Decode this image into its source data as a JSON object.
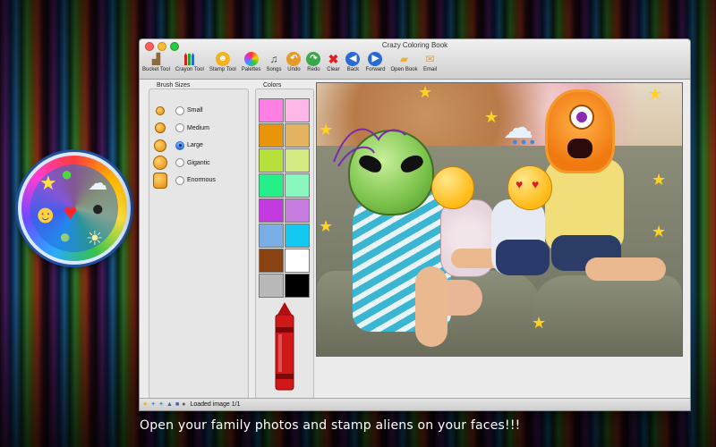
{
  "window": {
    "title": "Crazy Coloring Book"
  },
  "toolbar": {
    "items": [
      {
        "label": "Bucket Tool"
      },
      {
        "label": "Crayon Tool"
      },
      {
        "label": "Stamp Tool"
      },
      {
        "label": "Palettes"
      },
      {
        "label": "Songs"
      },
      {
        "label": "Undo"
      },
      {
        "label": "Redo"
      },
      {
        "label": "Clear"
      },
      {
        "label": "Back"
      },
      {
        "label": "Forward"
      },
      {
        "label": "Open Book"
      },
      {
        "label": "Email"
      }
    ]
  },
  "brush_sizes": {
    "title": "Brush Sizes",
    "options": [
      {
        "label": "Small",
        "selected": false
      },
      {
        "label": "Medium",
        "selected": false
      },
      {
        "label": "Large",
        "selected": true
      },
      {
        "label": "Gigantic",
        "selected": false
      },
      {
        "label": "Enormous",
        "selected": false
      }
    ]
  },
  "colors": {
    "title": "Colors",
    "swatches": [
      "#ff7fe5",
      "#ffb7ea",
      "#e8950b",
      "#e4b361",
      "#b5df3a",
      "#d4ea83",
      "#25ef88",
      "#8bf7c0",
      "#c23ae0",
      "#c77de0",
      "#7caee6",
      "#13c8f1",
      "#8a4212",
      "#ffffff",
      "#b9b9b9",
      "#000000"
    ],
    "selected_crayon_color": "#d01818"
  },
  "status": {
    "text": "Loaded image 1/1"
  },
  "caption": "Open your family photos and stamp aliens on your faces!!!"
}
